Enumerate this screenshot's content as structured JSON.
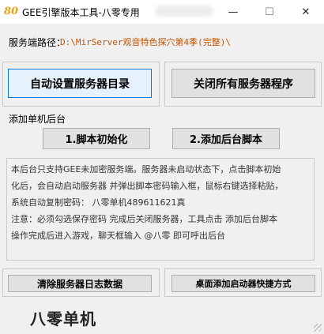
{
  "window": {
    "icon_text": "80",
    "title": "GEE引擎版本工具-八零专用",
    "minimize_glyph": "—",
    "maximize_glyph": "☐",
    "close_glyph": "✕"
  },
  "server_path": {
    "label": "服务端路径：",
    "value": "D:\\MirServer观音特色探穴第4季(完整)\\"
  },
  "top_buttons": {
    "auto_set_dir": "自动设置服务器目录",
    "close_all_servers": "关闭所有服务器程序"
  },
  "add_backend": {
    "group_label": "添加单机后台",
    "init_script": "1.脚本初始化",
    "add_backend_script": "2.添加后台脚本"
  },
  "info_lines": [
    "本后台只支持GEE未加密服务端。服务器未启动状态下，点击脚本初始",
    "化后，会自动启动服务器 并弹出脚本密码输入框，鼠标右键选择粘贴，",
    "系统自动复制密码： 八零单机489611621真",
    "注意：必须勾选保存密码 完成后关闭服务器，工具点击 添加后台脚本",
    "操作完成后进入游戏，聊天框输入  @八零  即可呼出后台"
  ],
  "bottom_buttons": {
    "clear_logs": "清除服务器日志数据",
    "desktop_shortcut": "桌面添加启动器快捷方式"
  },
  "brand": "八零单机"
}
